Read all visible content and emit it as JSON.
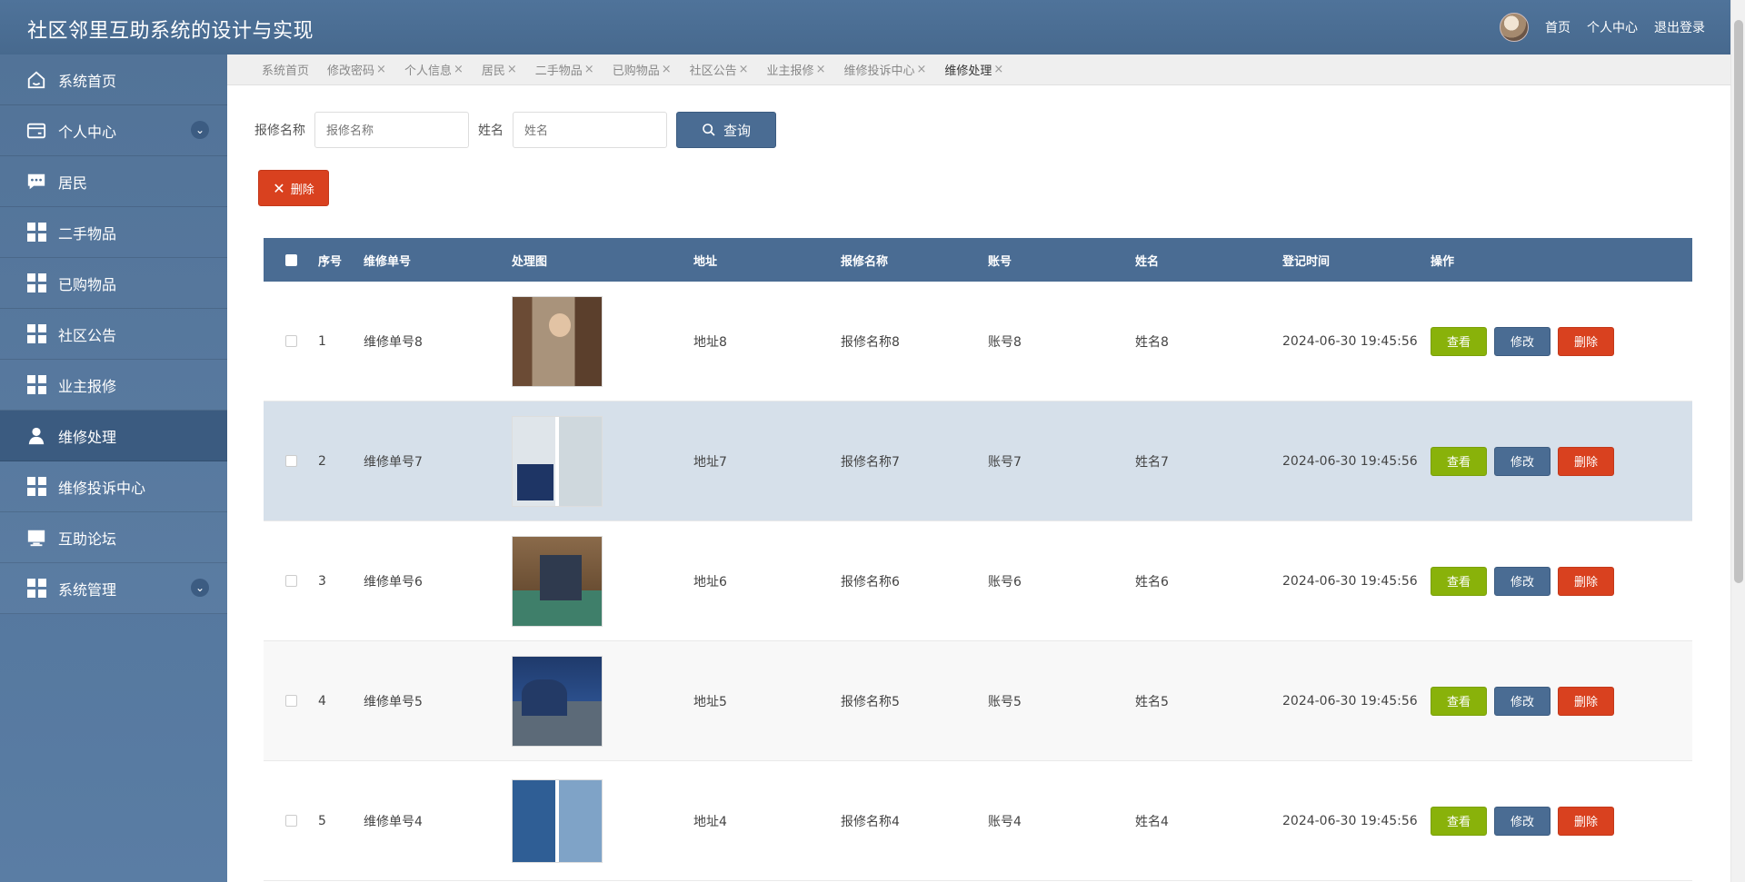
{
  "header": {
    "title": "社区邻里互助系统的设计与实现",
    "links": [
      "首页",
      "个人中心",
      "退出登录"
    ]
  },
  "sidebar": {
    "items": [
      {
        "label": "系统首页",
        "icon": "home-icon"
      },
      {
        "label": "个人中心",
        "icon": "wallet-icon"
      },
      {
        "label": "居民",
        "icon": "chat-icon"
      },
      {
        "label": "二手物品",
        "icon": "grid-icon"
      },
      {
        "label": "已购物品",
        "icon": "grid-icon"
      },
      {
        "label": "社区公告",
        "icon": "grid-icon"
      },
      {
        "label": "业主报修",
        "icon": "grid-icon"
      },
      {
        "label": "维修处理",
        "icon": "user-icon"
      },
      {
        "label": "维修投诉中心",
        "icon": "grid-icon"
      },
      {
        "label": "互助论坛",
        "icon": "monitor-icon"
      },
      {
        "label": "系统管理",
        "icon": "grid-icon"
      }
    ]
  },
  "tabs": [
    "系统首页",
    "修改密码",
    "个人信息",
    "居民",
    "二手物品",
    "已购物品",
    "社区公告",
    "业主报修",
    "维修投诉中心",
    "维修处理"
  ],
  "search": {
    "label1": "报修名称",
    "placeholder1": "报修名称",
    "label2": "姓名",
    "placeholder2": "姓名",
    "button": "查询"
  },
  "actions": {
    "delete": "删除"
  },
  "table": {
    "headers": [
      "序号",
      "维修单号",
      "处理图",
      "地址",
      "报修名称",
      "账号",
      "姓名",
      "登记时间",
      "操作"
    ],
    "rows": [
      {
        "idx": "1",
        "no": "维修单号8",
        "addr": "地址8",
        "name": "报修名称8",
        "acc": "账号8",
        "user": "姓名8",
        "time": "2024-06-30 19:45:56"
      },
      {
        "idx": "2",
        "no": "维修单号7",
        "addr": "地址7",
        "name": "报修名称7",
        "acc": "账号7",
        "user": "姓名7",
        "time": "2024-06-30 19:45:56"
      },
      {
        "idx": "3",
        "no": "维修单号6",
        "addr": "地址6",
        "name": "报修名称6",
        "acc": "账号6",
        "user": "姓名6",
        "time": "2024-06-30 19:45:56"
      },
      {
        "idx": "4",
        "no": "维修单号5",
        "addr": "地址5",
        "name": "报修名称5",
        "acc": "账号5",
        "user": "姓名5",
        "time": "2024-06-30 19:45:56"
      },
      {
        "idx": "5",
        "no": "维修单号4",
        "addr": "地址4",
        "name": "报修名称4",
        "acc": "账号4",
        "user": "姓名4",
        "time": "2024-06-30 19:45:56"
      }
    ],
    "ops": {
      "view": "查看",
      "edit": "修改",
      "delete": "删除"
    }
  }
}
